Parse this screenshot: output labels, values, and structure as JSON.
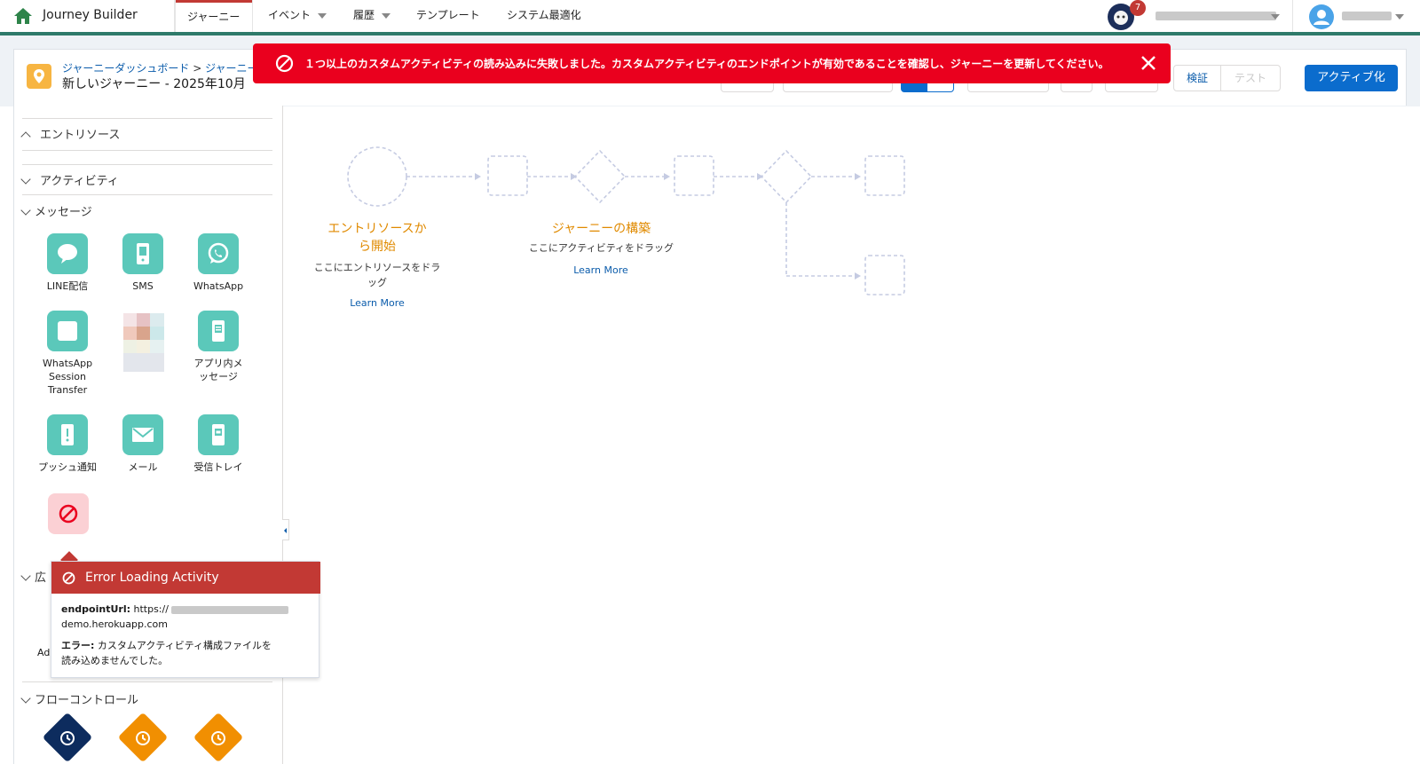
{
  "app": {
    "title": "Journey Builder"
  },
  "nav": {
    "tabs": [
      {
        "label": "ジャーニー",
        "active": true
      },
      {
        "label": "イベント",
        "dropdown": true
      },
      {
        "label": "履歴",
        "dropdown": true
      },
      {
        "label": "テンプレート"
      },
      {
        "label": "システム最適化"
      }
    ],
    "notification_count": "7"
  },
  "header": {
    "breadcrumb_parent": "ジャーニーダッシュボード",
    "breadcrumb_sep": ">",
    "breadcrumb_current": "ジャーニー",
    "journey_name": "新しいジャーニー - 2025年10月",
    "validate_label": "検証",
    "test_label": "テスト",
    "activate_label": "アクティブ化"
  },
  "toast": {
    "message": "１つ以上のカスタムアクティビティの読み込みに失敗しました。カスタムアクティビティのエンドポイントが有効であることを確認し、ジャーニーを更新してください。",
    "color": "#ea001e"
  },
  "sidebar": {
    "sections": {
      "entry_sources": "エントリソース",
      "activities": "アクティビティ",
      "messages": "メッセージ",
      "ads_partial": "広",
      "flow_control": "フローコントロール"
    },
    "message_activities": [
      {
        "label": "LINE配信",
        "icon": "chat-bubble-icon"
      },
      {
        "label": "SMS",
        "icon": "mobile-icon"
      },
      {
        "label": "WhatsApp",
        "icon": "whatsapp-icon"
      },
      {
        "label": "WhatsApp Session Transfer",
        "icon": "blank-square-icon"
      },
      {
        "label": "アプリ内メッセージ",
        "icon": "in-app-icon"
      },
      {
        "label": "プッシュ通知",
        "icon": "push-icon"
      },
      {
        "label": "メール",
        "icon": "email-icon"
      },
      {
        "label": "受信トレイ",
        "icon": "inbox-icon"
      }
    ],
    "ads_item_partial": "Ad"
  },
  "popover": {
    "title": "Error Loading Activity",
    "endpoint_label": "endpointUrl:",
    "endpoint_prefix": "https://",
    "endpoint_suffix": "demo.herokuapp.com",
    "error_label": "エラー:",
    "error_text_1": "カスタムアクティビティ構成ファイルを",
    "error_text_2": "読み込めませんでした。"
  },
  "canvas": {
    "entry_title_1": "エントリソースか",
    "entry_title_2": "ら開始",
    "entry_desc_1": "ここにエントリソースをドラ",
    "entry_desc_2": "ッグ",
    "entry_link": "Learn More",
    "build_title": "ジャーニーの構築",
    "build_desc": "ここにアクティビティをドラッグ",
    "build_link": "Learn More"
  },
  "colors": {
    "accent_orange": "#e08a00",
    "teal_tile": "#5bc8ba",
    "activate_blue": "#0b6ccd",
    "error_red": "#c23934"
  }
}
